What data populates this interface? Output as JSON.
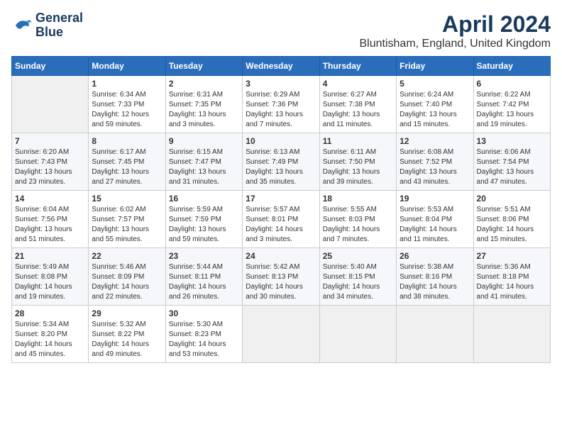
{
  "logo": {
    "line1": "General",
    "line2": "Blue"
  },
  "title": "April 2024",
  "location": "Bluntisham, England, United Kingdom",
  "days_of_week": [
    "Sunday",
    "Monday",
    "Tuesday",
    "Wednesday",
    "Thursday",
    "Friday",
    "Saturday"
  ],
  "weeks": [
    [
      {
        "day": "",
        "info": ""
      },
      {
        "day": "1",
        "info": "Sunrise: 6:34 AM\nSunset: 7:33 PM\nDaylight: 12 hours\nand 59 minutes."
      },
      {
        "day": "2",
        "info": "Sunrise: 6:31 AM\nSunset: 7:35 PM\nDaylight: 13 hours\nand 3 minutes."
      },
      {
        "day": "3",
        "info": "Sunrise: 6:29 AM\nSunset: 7:36 PM\nDaylight: 13 hours\nand 7 minutes."
      },
      {
        "day": "4",
        "info": "Sunrise: 6:27 AM\nSunset: 7:38 PM\nDaylight: 13 hours\nand 11 minutes."
      },
      {
        "day": "5",
        "info": "Sunrise: 6:24 AM\nSunset: 7:40 PM\nDaylight: 13 hours\nand 15 minutes."
      },
      {
        "day": "6",
        "info": "Sunrise: 6:22 AM\nSunset: 7:42 PM\nDaylight: 13 hours\nand 19 minutes."
      }
    ],
    [
      {
        "day": "7",
        "info": "Sunrise: 6:20 AM\nSunset: 7:43 PM\nDaylight: 13 hours\nand 23 minutes."
      },
      {
        "day": "8",
        "info": "Sunrise: 6:17 AM\nSunset: 7:45 PM\nDaylight: 13 hours\nand 27 minutes."
      },
      {
        "day": "9",
        "info": "Sunrise: 6:15 AM\nSunset: 7:47 PM\nDaylight: 13 hours\nand 31 minutes."
      },
      {
        "day": "10",
        "info": "Sunrise: 6:13 AM\nSunset: 7:49 PM\nDaylight: 13 hours\nand 35 minutes."
      },
      {
        "day": "11",
        "info": "Sunrise: 6:11 AM\nSunset: 7:50 PM\nDaylight: 13 hours\nand 39 minutes."
      },
      {
        "day": "12",
        "info": "Sunrise: 6:08 AM\nSunset: 7:52 PM\nDaylight: 13 hours\nand 43 minutes."
      },
      {
        "day": "13",
        "info": "Sunrise: 6:06 AM\nSunset: 7:54 PM\nDaylight: 13 hours\nand 47 minutes."
      }
    ],
    [
      {
        "day": "14",
        "info": "Sunrise: 6:04 AM\nSunset: 7:56 PM\nDaylight: 13 hours\nand 51 minutes."
      },
      {
        "day": "15",
        "info": "Sunrise: 6:02 AM\nSunset: 7:57 PM\nDaylight: 13 hours\nand 55 minutes."
      },
      {
        "day": "16",
        "info": "Sunrise: 5:59 AM\nSunset: 7:59 PM\nDaylight: 13 hours\nand 59 minutes."
      },
      {
        "day": "17",
        "info": "Sunrise: 5:57 AM\nSunset: 8:01 PM\nDaylight: 14 hours\nand 3 minutes."
      },
      {
        "day": "18",
        "info": "Sunrise: 5:55 AM\nSunset: 8:03 PM\nDaylight: 14 hours\nand 7 minutes."
      },
      {
        "day": "19",
        "info": "Sunrise: 5:53 AM\nSunset: 8:04 PM\nDaylight: 14 hours\nand 11 minutes."
      },
      {
        "day": "20",
        "info": "Sunrise: 5:51 AM\nSunset: 8:06 PM\nDaylight: 14 hours\nand 15 minutes."
      }
    ],
    [
      {
        "day": "21",
        "info": "Sunrise: 5:49 AM\nSunset: 8:08 PM\nDaylight: 14 hours\nand 19 minutes."
      },
      {
        "day": "22",
        "info": "Sunrise: 5:46 AM\nSunset: 8:09 PM\nDaylight: 14 hours\nand 22 minutes."
      },
      {
        "day": "23",
        "info": "Sunrise: 5:44 AM\nSunset: 8:11 PM\nDaylight: 14 hours\nand 26 minutes."
      },
      {
        "day": "24",
        "info": "Sunrise: 5:42 AM\nSunset: 8:13 PM\nDaylight: 14 hours\nand 30 minutes."
      },
      {
        "day": "25",
        "info": "Sunrise: 5:40 AM\nSunset: 8:15 PM\nDaylight: 14 hours\nand 34 minutes."
      },
      {
        "day": "26",
        "info": "Sunrise: 5:38 AM\nSunset: 8:16 PM\nDaylight: 14 hours\nand 38 minutes."
      },
      {
        "day": "27",
        "info": "Sunrise: 5:36 AM\nSunset: 8:18 PM\nDaylight: 14 hours\nand 41 minutes."
      }
    ],
    [
      {
        "day": "28",
        "info": "Sunrise: 5:34 AM\nSunset: 8:20 PM\nDaylight: 14 hours\nand 45 minutes."
      },
      {
        "day": "29",
        "info": "Sunrise: 5:32 AM\nSunset: 8:22 PM\nDaylight: 14 hours\nand 49 minutes."
      },
      {
        "day": "30",
        "info": "Sunrise: 5:30 AM\nSunset: 8:23 PM\nDaylight: 14 hours\nand 53 minutes."
      },
      {
        "day": "",
        "info": ""
      },
      {
        "day": "",
        "info": ""
      },
      {
        "day": "",
        "info": ""
      },
      {
        "day": "",
        "info": ""
      }
    ]
  ]
}
